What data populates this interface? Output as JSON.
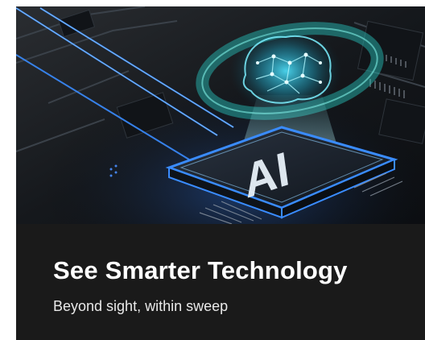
{
  "banner": {
    "title": "See Smarter Technology",
    "subtitle": "Beyond sight, within sweep",
    "chip_label": "AI",
    "colors": {
      "background": "#1a1a1a",
      "accent_blue": "#3a8cff",
      "accent_teal": "#27c8c0",
      "title_text": "#ffffff"
    }
  }
}
